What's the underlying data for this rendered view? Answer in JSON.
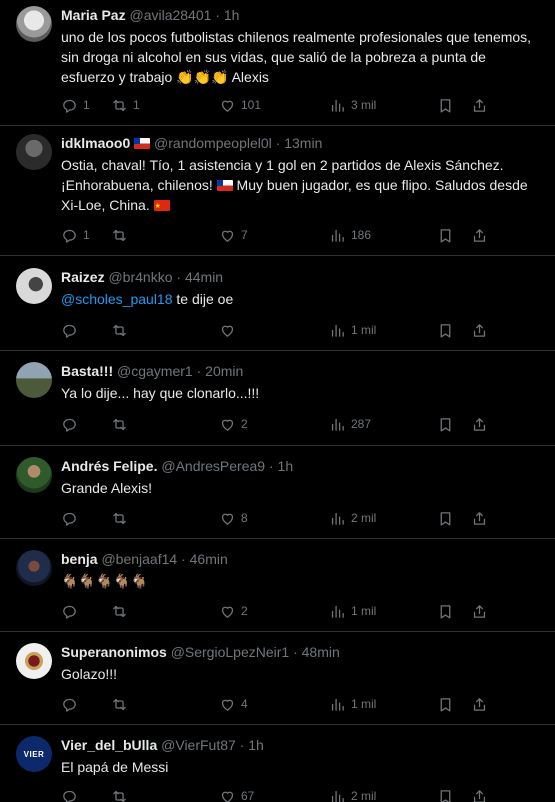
{
  "tweets": [
    {
      "name": "Maria Paz",
      "handle": "@avila28401",
      "time": "1h",
      "text": "uno de los pocos futbolistas chilenos realmente profesionales que tenemos, sin droga ni alcohol en sus vidas, que salió de la pobreza a punta de esfuerzo y trabajo 👏👏👏 Alexis",
      "replies": "1",
      "retweets": "1",
      "likes": "101",
      "views": "3 mil",
      "avatar_color": "#cfcfcf"
    },
    {
      "name": "idklmaoo0",
      "handle": "@randompeoplel0l",
      "time": "13min",
      "text_before_flag1": "Ostia, chaval! Tío, 1 asistencia y 1 gol en 2 partidos de Alexis Sánchez. ¡Enhorabuena, chilenos! ",
      "text_between_flags": " Muy buen jugador, es que flipo. Saludos desde Xi-Loe, China. ",
      "replies": "1",
      "retweets": "",
      "likes": "7",
      "views": "186",
      "avatar_color": "#3a3a3a"
    },
    {
      "name": "Raizez",
      "handle": "@br4nkko",
      "time": "44min",
      "mention": "@scholes_paul18",
      "text": " te dije oe",
      "replies": "",
      "retweets": "",
      "likes": "",
      "views": "1 mil",
      "avatar_color": "#d8d8d8"
    },
    {
      "name": "Basta!!!",
      "handle": "@cgaymer1",
      "time": "20min",
      "text": "Ya lo dije... hay que clonarlo...!!!",
      "replies": "",
      "retweets": "",
      "likes": "2",
      "views": "287",
      "avatar_color": "#6d7f8a"
    },
    {
      "name": "Andrés Felipe.",
      "handle": "@AndresPerea9",
      "time": "1h",
      "text": "Grande Alexis!",
      "replies": "",
      "retweets": "",
      "likes": "8",
      "views": "2 mil",
      "avatar_color": "#3f6b3a"
    },
    {
      "name": "benja",
      "handle": "@benjaaf14",
      "time": "46min",
      "text": "🐐🐐🐐🐐🐐",
      "replies": "",
      "retweets": "",
      "likes": "2",
      "views": "1 mil",
      "avatar_color": "#2a3a5a"
    },
    {
      "name": "Superanonimos",
      "handle": "@SergioLpezNeir1",
      "time": "48min",
      "text": "Golazo!!!",
      "replies": "",
      "retweets": "",
      "likes": "4",
      "views": "1 mil",
      "avatar_color": "#eeeeee"
    },
    {
      "name": "Vier_del_bUlla",
      "handle": "@VierFut87",
      "time": "1h",
      "text": "El papá de Messi",
      "replies": "",
      "retweets": "",
      "likes": "67",
      "views": "2 mil",
      "avatar_color": "#0c2a6b",
      "avatar_label": "VIER"
    }
  ],
  "separator": "·"
}
